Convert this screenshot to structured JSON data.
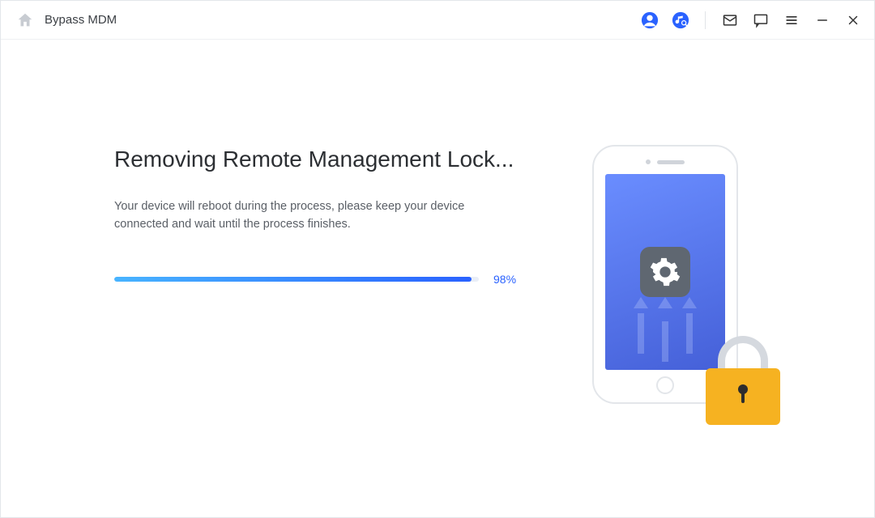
{
  "titlebar": {
    "title": "Bypass MDM"
  },
  "main": {
    "heading": "Removing Remote Management Lock...",
    "subtext": "Your device will reboot during the process, please keep your device connected and wait until the process finishes.",
    "progress_percent": 98,
    "progress_label": "98%"
  },
  "icons": {
    "home": "home-icon",
    "account": "account-icon",
    "music": "music-search-icon",
    "mail": "mail-icon",
    "chat": "chat-icon",
    "menu": "menu-icon",
    "minimize": "minimize-icon",
    "close": "close-icon",
    "gear": "gear-icon",
    "lock": "lock-icon",
    "phone": "phone-illustration"
  },
  "colors": {
    "accent_gradient_from": "#48b4ff",
    "accent_gradient_to": "#2a62ff",
    "lock_body": "#f6b221",
    "phone_screen_from": "#6a8dff",
    "phone_screen_to": "#4560d8"
  }
}
